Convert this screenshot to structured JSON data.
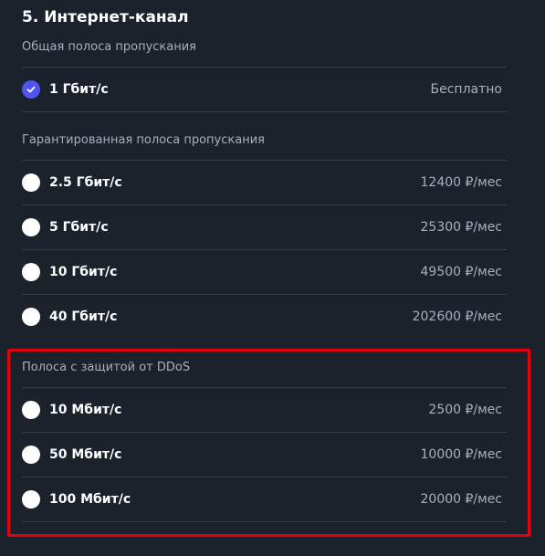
{
  "section": {
    "title": "5. Интернет-канал"
  },
  "groups": [
    {
      "label": "Общая полоса пропускания",
      "options": [
        {
          "label": "1 Гбит/с",
          "price": "Бесплатно",
          "selected": true
        }
      ]
    },
    {
      "label": "Гарантированная полоса пропускания",
      "options": [
        {
          "label": "2.5 Гбит/с",
          "price": "12400 ₽/мес",
          "selected": false
        },
        {
          "label": "5 Гбит/с",
          "price": "25300 ₽/мес",
          "selected": false
        },
        {
          "label": "10 Гбит/с",
          "price": "49500 ₽/мес",
          "selected": false
        },
        {
          "label": "40 Гбит/с",
          "price": "202600 ₽/мес",
          "selected": false
        }
      ]
    },
    {
      "label": "Полоса с защитой от DDoS",
      "options": [
        {
          "label": "10 Мбит/с",
          "price": "2500 ₽/мес",
          "selected": false
        },
        {
          "label": "50 Мбит/с",
          "price": "10000 ₽/мес",
          "selected": false
        },
        {
          "label": "100 Мбит/с",
          "price": "20000 ₽/мес",
          "selected": false
        }
      ]
    }
  ],
  "colors": {
    "background": "#1b222c",
    "accent": "#4f56f0",
    "highlight": "#e3000f",
    "muted_text": "#a6b0be"
  },
  "icons": {
    "selected_marker": "check-icon"
  }
}
